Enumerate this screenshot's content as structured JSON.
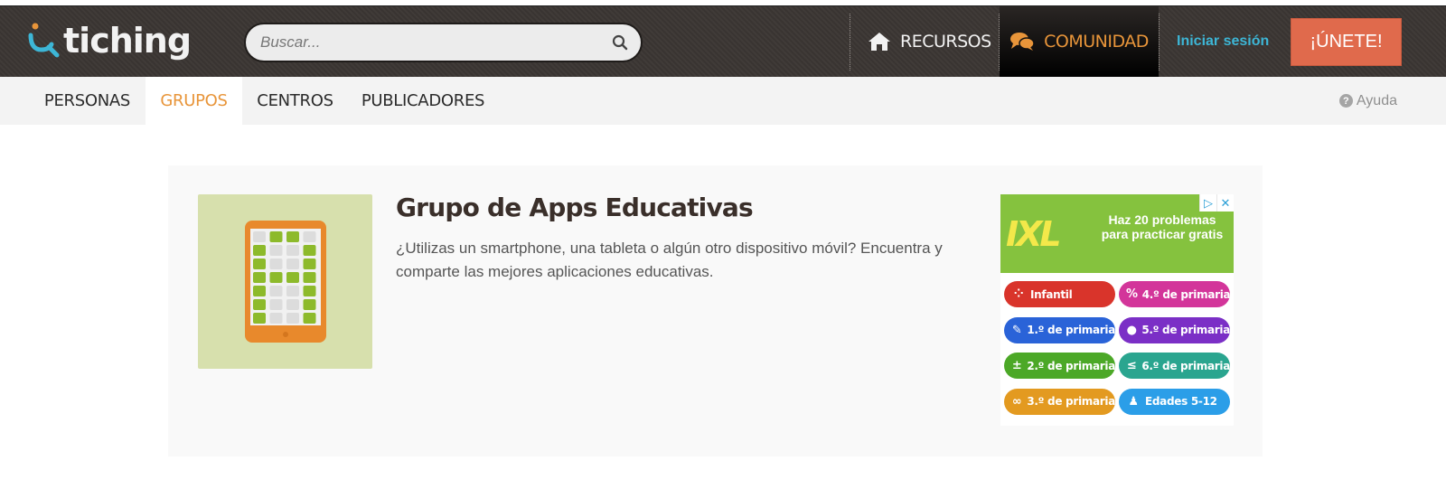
{
  "header": {
    "logo_text": "tiching",
    "search": {
      "placeholder": "Buscar..."
    },
    "nav": [
      {
        "label": "RECURSOS",
        "icon": "home-icon",
        "active": false
      },
      {
        "label": "COMUNIDAD",
        "icon": "chat-bubbles-icon",
        "active": true
      }
    ],
    "login_label": "Iniciar sesión",
    "join_label": "¡ÚNETE!"
  },
  "subnav": {
    "tabs": [
      {
        "label": "PERSONAS",
        "active": false
      },
      {
        "label": "GRUPOS",
        "active": true
      },
      {
        "label": "CENTROS",
        "active": false
      },
      {
        "label": "PUBLICADORES",
        "active": false
      }
    ],
    "help_label": "Ayuda"
  },
  "group": {
    "title": "Grupo de Apps Educativas",
    "description": "¿Utilizas un smartphone, una tableta o algún otro dispositivo móvil? Encuentra y comparte las mejores aplicaciones educativas."
  },
  "ad": {
    "logo_text": "IXL",
    "banner_text": "Haz 20 problemas para practicar gratis",
    "pills": [
      {
        "label": "Infantil",
        "icon": "dots-icon",
        "color": "#d9342b"
      },
      {
        "label": "4.º de primaria",
        "icon": "percent-icon",
        "color": "#d3359a"
      },
      {
        "label": "1.º de primaria",
        "icon": "pencil-cup-icon",
        "color": "#2a63d8"
      },
      {
        "label": "5.º de primaria",
        "icon": "apple-icon",
        "color": "#7b2fc6"
      },
      {
        "label": "2.º de primaria",
        "icon": "plus-minus-icon",
        "color": "#4ca827"
      },
      {
        "label": "6.º de primaria",
        "icon": "less-equal-icon",
        "color": "#2aa58f"
      },
      {
        "label": "3.º de primaria",
        "icon": "infinity-icon",
        "color": "#e39a20"
      },
      {
        "label": "Edades 5-12",
        "icon": "people-icon",
        "color": "#2b9ee8"
      }
    ]
  },
  "colors": {
    "accent_orange": "#e8953a",
    "join_button": "#e06a4c",
    "login_link": "#3db6d6",
    "topbar": "#3b3633"
  }
}
